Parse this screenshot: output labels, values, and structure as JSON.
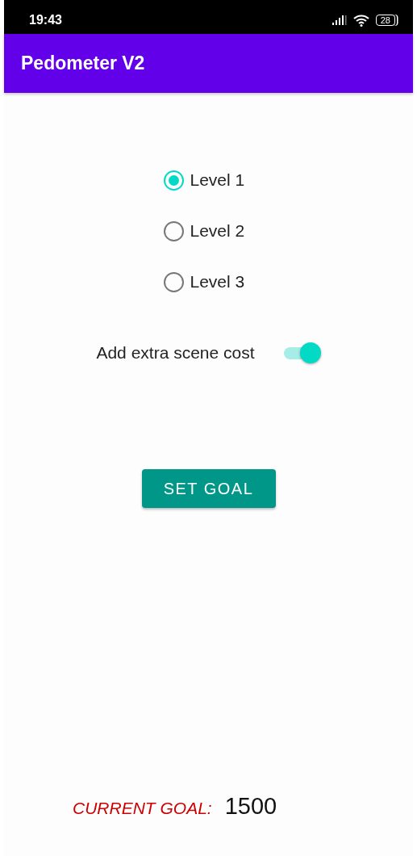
{
  "status_bar": {
    "time": "19:43",
    "battery": "28"
  },
  "app_bar": {
    "title": "Pedometer V2"
  },
  "levels": [
    {
      "label": "Level 1",
      "selected": true
    },
    {
      "label": "Level 2",
      "selected": false
    },
    {
      "label": "Level 3",
      "selected": false
    }
  ],
  "extra_cost": {
    "label": "Add extra scene cost",
    "on": true
  },
  "set_goal_button": "SET GOAL",
  "current_goal": {
    "label": "CURRENT GOAL:",
    "value": "1500"
  }
}
